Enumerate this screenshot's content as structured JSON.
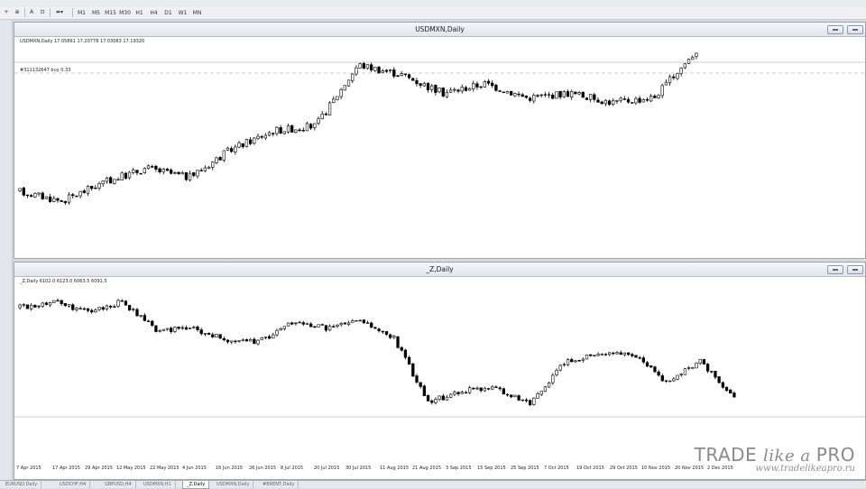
{
  "toolbar": {
    "timeframes": [
      "M1",
      "M5",
      "M15",
      "M30",
      "H1",
      "H4",
      "D1",
      "W1",
      "MN"
    ]
  },
  "chart1": {
    "title": "USDMXN,Daily",
    "info": "USDMXN,Daily  17.05861 17.20778 17.03083 17.19320",
    "order_label": "#311132647 buy 0.33"
  },
  "chart2": {
    "title": "_Z,Daily",
    "info": "_Z,Daily  6102.0 6123.0 6063.5 6091.5",
    "date_axis": [
      "7 Apr 2015",
      "17 Apr 2015",
      "29 Apr 2015",
      "12 May 2015",
      "22 May 2015",
      "4 Jun 2015",
      "16 Jun 2015",
      "26 Jun 2015",
      "8 Jul 2015",
      "20 Jul 2015",
      "30 Jul 2015",
      "11 Aug 2015",
      "21 Aug 2015",
      "3 Sep 2015",
      "15 Sep 2015",
      "25 Sep 2015",
      "7 Oct 2015",
      "19 Oct 2015",
      "29 Oct 2015",
      "10 Nov 2015",
      "20 Nov 2015",
      "2 Dec 2015"
    ]
  },
  "tabs": [
    "EURUSD,Daily",
    "USDCHF,H4",
    "GBPUSD,H4",
    "USDMXN,H1",
    "_Z,Daily",
    "USDMXN,Daily",
    "#BRENT,Daily"
  ],
  "active_tab": "_Z,Daily",
  "watermark": {
    "brand_left": "TRADE ",
    "brand_mid": "like a ",
    "brand_right": "PRO",
    "url": "www.tradelikeapro.ru"
  },
  "chart_data": [
    {
      "type": "candlestick",
      "symbol": "USDMXN",
      "timeframe": "Daily",
      "ohlc_last": {
        "open": 17.05861,
        "high": 17.20778,
        "low": 17.03083,
        "close": 17.1932
      },
      "trend_path_y": [
        16.45,
        16.35,
        16.55,
        16.7,
        16.6,
        16.9,
        17.1,
        17.15,
        17.8,
        17.7,
        17.5,
        17.6,
        17.45,
        17.5,
        17.4,
        17.45,
        17.95
      ],
      "ymin": 15.8,
      "ymax": 18.0
    },
    {
      "type": "candlestick",
      "symbol": "_Z",
      "timeframe": "Daily",
      "ohlc_last": {
        "open": 6102.0,
        "high": 6123.0,
        "low": 6063.5,
        "close": 6091.5
      },
      "x": [
        "7 Apr 2015",
        "17 Apr 2015",
        "29 Apr 2015",
        "12 May 2015",
        "22 May 2015",
        "4 Jun 2015",
        "16 Jun 2015",
        "26 Jun 2015",
        "8 Jul 2015",
        "20 Jul 2015",
        "30 Jul 2015",
        "11 Aug 2015",
        "21 Aug 2015",
        "3 Sep 2015",
        "15 Sep 2015",
        "25 Sep 2015",
        "7 Oct 2015",
        "19 Oct 2015",
        "29 Oct 2015",
        "10 Nov 2015",
        "20 Nov 2015",
        "2 Dec 2015"
      ],
      "trend_path_y": [
        6960,
        7020,
        6920,
        7010,
        6760,
        6780,
        6680,
        6650,
        6830,
        6780,
        6840,
        6690,
        6120,
        6220,
        6250,
        6100,
        6480,
        6560,
        6550,
        6300,
        6480,
        6150
      ],
      "ymin": 5800,
      "ymax": 7150
    }
  ]
}
